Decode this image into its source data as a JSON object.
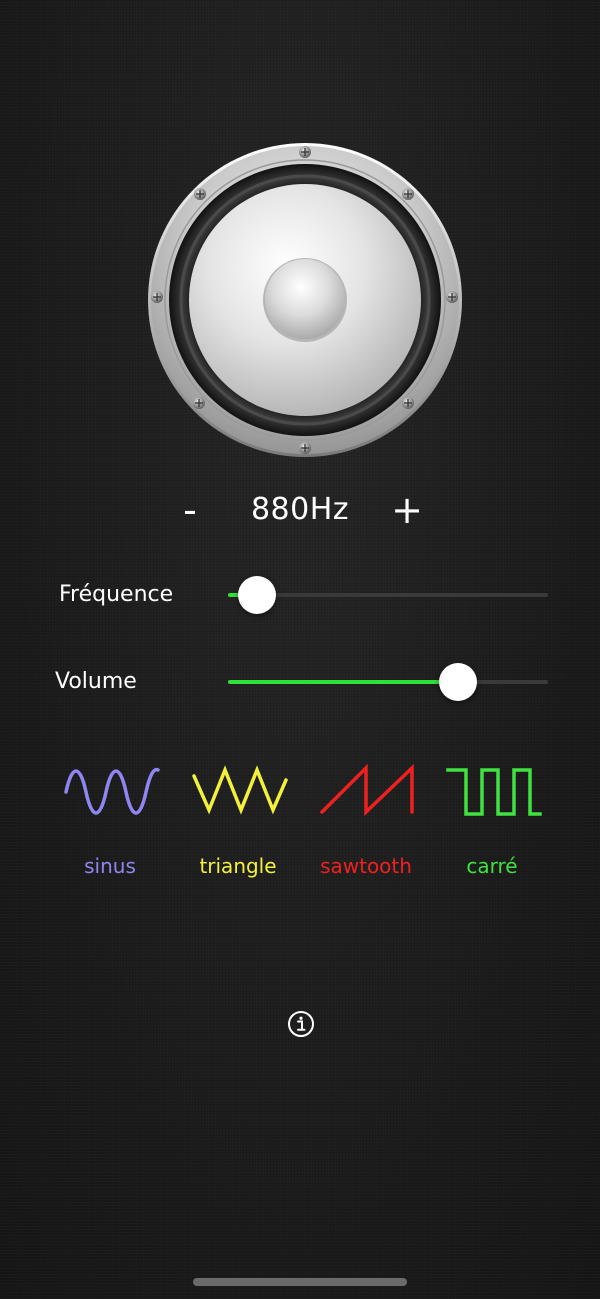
{
  "frequency": {
    "minus_label": "-",
    "value_label": "880Hz",
    "plus_label": "+"
  },
  "sliders": {
    "frequency": {
      "label": "Fréquence",
      "value": 0.09
    },
    "volume": {
      "label": "Volume",
      "value": 0.72
    }
  },
  "waveforms": [
    {
      "label": "sinus",
      "color": "#8f86f2",
      "icon": "sine-wave-icon"
    },
    {
      "label": "triangle",
      "color": "#f4f13a",
      "icon": "triangle-wave-icon"
    },
    {
      "label": "sawtooth",
      "color": "#ef2020",
      "icon": "sawtooth-wave-icon"
    },
    {
      "label": "carré",
      "color": "#3fe23f",
      "icon": "square-wave-icon"
    }
  ],
  "colors": {
    "slider_fill": "#2fe03a",
    "background": "#1d1d1d"
  },
  "icons": {
    "speaker": "speaker-icon",
    "info": "info-icon"
  }
}
